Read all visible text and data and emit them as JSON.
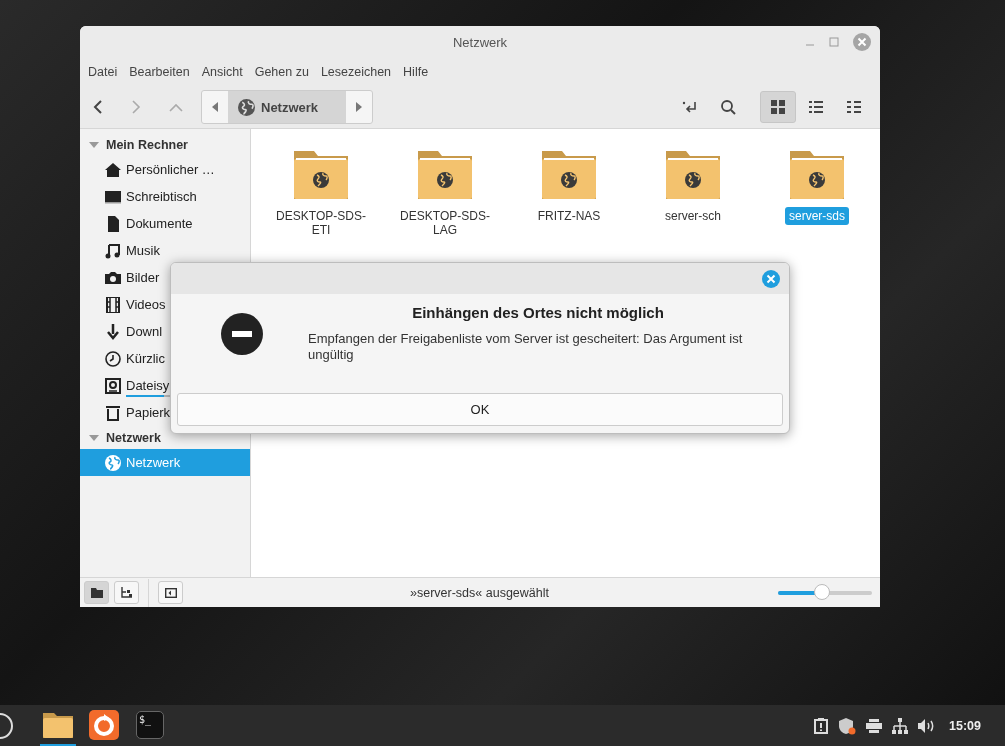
{
  "window": {
    "title": "Netzwerk"
  },
  "menu": [
    "Datei",
    "Bearbeiten",
    "Ansicht",
    "Gehen zu",
    "Lesezeichen",
    "Hilfe"
  ],
  "path": {
    "label": "Netzwerk"
  },
  "view_buttons": [
    {
      "kind": "icons",
      "selected": true
    },
    {
      "kind": "list",
      "selected": false
    },
    {
      "kind": "compact",
      "selected": false
    }
  ],
  "sidebar": {
    "sections": [
      {
        "label": "Mein Rechner",
        "expanded": true,
        "items": [
          {
            "label": "Persönlicher …",
            "selected": false
          },
          {
            "label": "Schreibtisch",
            "selected": false
          },
          {
            "label": "Dokumente",
            "selected": false
          },
          {
            "label": "Musik",
            "selected": false
          },
          {
            "label": "Bilder",
            "selected": false
          },
          {
            "label": "Videos",
            "selected": false
          },
          {
            "label": "Downl",
            "selected": false
          },
          {
            "label": "Kürzlic",
            "selected": false
          },
          {
            "label": "Dateisy",
            "selected": false,
            "level": 0.45
          },
          {
            "label": "Papierk",
            "selected": false
          }
        ]
      },
      {
        "label": "Netzwerk",
        "expanded": true,
        "items": [
          {
            "label": "Netzwerk",
            "selected": true
          }
        ]
      }
    ]
  },
  "files": [
    {
      "name": "DESKTOP-SDS-ETI",
      "selected": false
    },
    {
      "name": "DESKTOP-SDS-LAG",
      "selected": false
    },
    {
      "name": "FRITZ-NAS",
      "selected": false
    },
    {
      "name": "server-sch",
      "selected": false
    },
    {
      "name": "server-sds",
      "selected": true
    }
  ],
  "status_bar": {
    "pane_buttons": [
      {
        "kind": "places",
        "selected": true
      },
      {
        "kind": "tree",
        "selected": false
      }
    ],
    "text": "»server-sds« ausgewählt",
    "zoom": {
      "level": 0.48
    }
  },
  "dialog": {
    "title": "Einhängen des Ortes nicht möglich",
    "message": "Empfangen der Freigabenliste vom Server ist gescheitert: Das Argument ist ungültig",
    "button": "OK"
  },
  "taskbar": {
    "apps": [
      {
        "kind": "files",
        "active": true
      },
      {
        "kind": "browser",
        "active": false
      },
      {
        "kind": "terminal",
        "active": false
      }
    ],
    "terminal_glyph": "$_",
    "clock": "15:09"
  }
}
